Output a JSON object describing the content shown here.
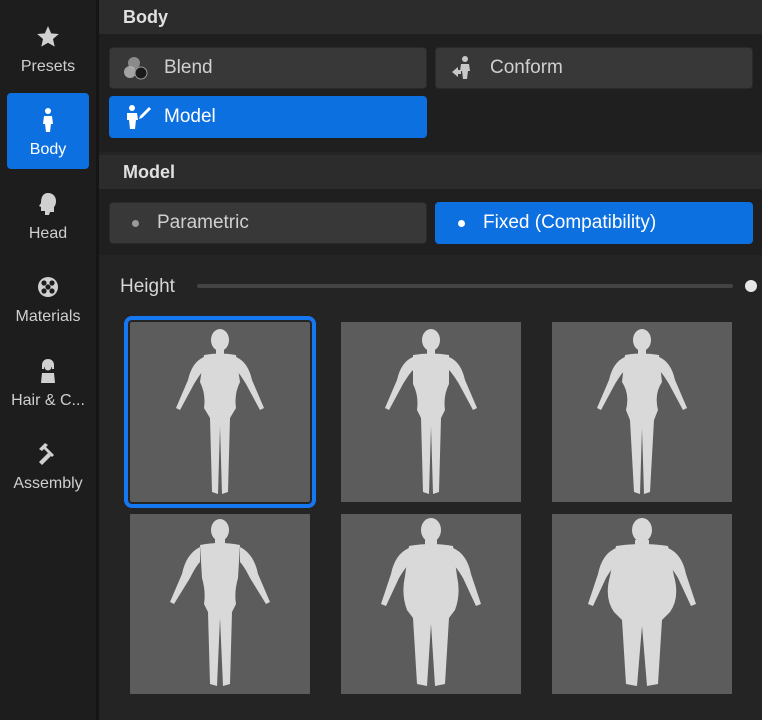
{
  "sidebar": {
    "items": [
      {
        "label": "Presets",
        "icon": "star-icon"
      },
      {
        "label": "Body",
        "icon": "person-icon",
        "active": true
      },
      {
        "label": "Head",
        "icon": "head-icon"
      },
      {
        "label": "Materials",
        "icon": "materials-icon"
      },
      {
        "label": "Hair & C...",
        "icon": "hair-icon"
      },
      {
        "label": "Assembly",
        "icon": "hammer-icon"
      }
    ]
  },
  "body_section": {
    "title": "Body",
    "buttons": [
      {
        "label": "Blend",
        "icon": "blend-icon"
      },
      {
        "label": "Conform",
        "icon": "conform-icon"
      },
      {
        "label": "Model",
        "icon": "model-icon",
        "selected": true
      }
    ]
  },
  "model_section": {
    "title": "Model",
    "options": [
      {
        "label": "Parametric",
        "selected": false
      },
      {
        "label": "Fixed (Compatibility)",
        "selected": true
      }
    ],
    "height_label": "Height",
    "height_value": 1.0,
    "selected_preset_index": 0
  },
  "colors": {
    "accent": "#0d70e0",
    "thumb_bg": "#5c5c5c",
    "panel_bg": "#1f1f1f"
  }
}
